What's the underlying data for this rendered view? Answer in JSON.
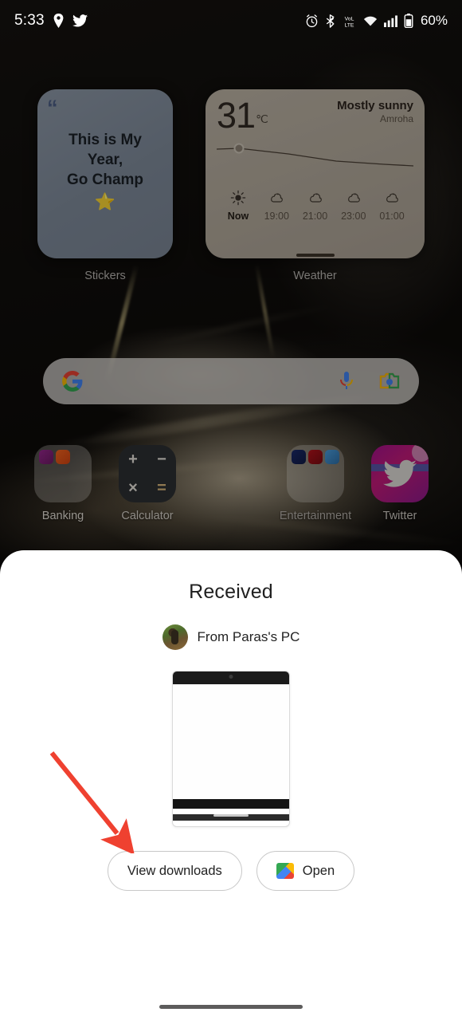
{
  "status_bar": {
    "time": "5:33",
    "left_icons": [
      "location-pin-icon",
      "twitter-icon"
    ],
    "right_icons": [
      "alarm-icon",
      "bluetooth-icon",
      "volte-icon",
      "wifi-icon",
      "signal-icon",
      "battery-icon"
    ],
    "battery_percent": "60%"
  },
  "home": {
    "widgets": [
      {
        "name": "Stickers",
        "label": "Stickers",
        "quote_glyph": "“",
        "text_lines": [
          "This is My",
          "Year,",
          "Go Champ"
        ],
        "emoji": "⭐",
        "color": "#848f9e"
      },
      {
        "name": "Weather",
        "label": "Weather",
        "temperature": "31",
        "unit": "℃",
        "condition": "Mostly sunny",
        "location": "Amroha",
        "color": "#b5ac9e",
        "hourly": [
          {
            "time": "Now",
            "icon": "sun-icon"
          },
          {
            "time": "19:00",
            "icon": "night-cloud-icon"
          },
          {
            "time": "21:00",
            "icon": "night-cloud-icon"
          },
          {
            "time": "23:00",
            "icon": "night-cloud-icon"
          },
          {
            "time": "01:00",
            "icon": "night-cloud-icon"
          }
        ]
      }
    ],
    "search": {
      "placeholder": "",
      "value": "",
      "google_icon": "google-g-icon",
      "mic_icon": "microphone-icon",
      "lens_icon": "google-lens-icon"
    },
    "apps": [
      {
        "label": "Banking",
        "type": "folder",
        "icon": "banking-folder-icon"
      },
      {
        "label": "Calculator",
        "type": "app",
        "icon": "calculator-icon",
        "glyphs": [
          "+",
          "−",
          "×",
          "="
        ]
      },
      {
        "label": "Entertainment",
        "type": "folder",
        "icon": "entertainment-folder-icon"
      },
      {
        "label": "Twitter",
        "type": "app",
        "icon": "twitter-app-icon",
        "badge": true
      }
    ]
  },
  "sheet": {
    "title": "Received",
    "sender": "From Paras's PC",
    "avatar_icon": "sender-avatar",
    "preview_icon": "screenshot-thumbnail",
    "buttons": [
      {
        "label": "View downloads",
        "icon": null
      },
      {
        "label": "Open",
        "icon": "gallery-icon"
      }
    ]
  },
  "annotation": {
    "arrow_color": "#ef4130",
    "points_to": "View downloads"
  },
  "nav_bar": {
    "gesture_pill": "home-indicator"
  }
}
